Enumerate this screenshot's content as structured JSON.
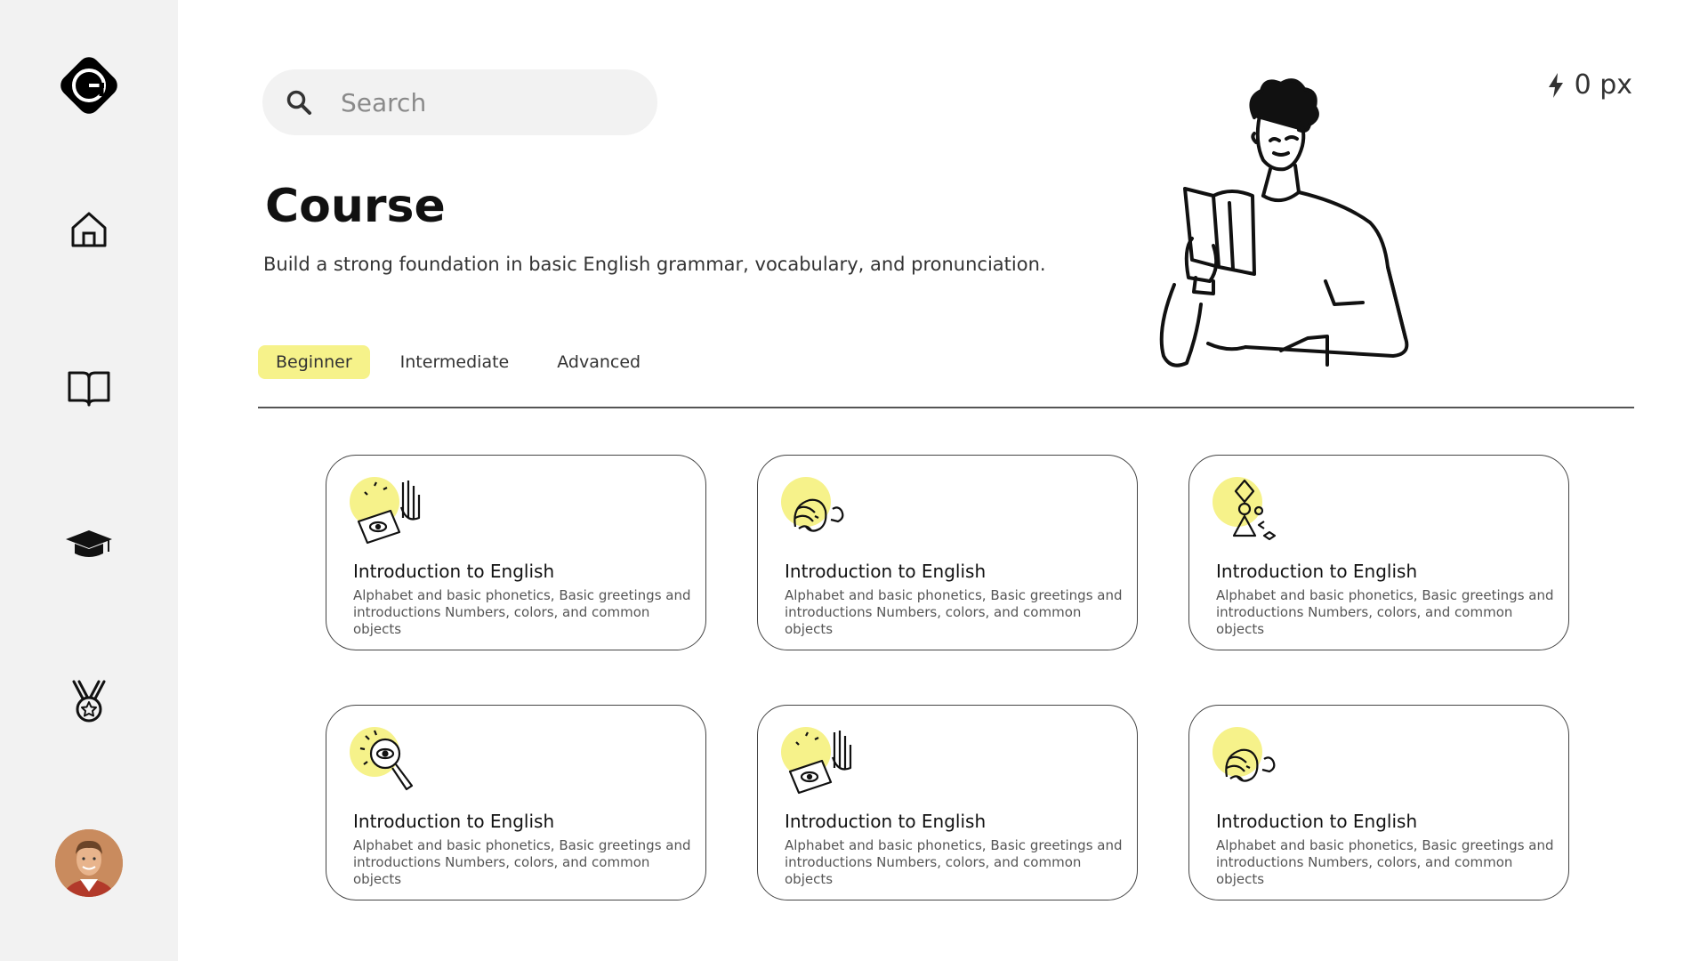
{
  "search": {
    "placeholder": "Search"
  },
  "points": {
    "value": "0 px"
  },
  "page": {
    "title": "Course",
    "subtitle": "Build a strong foundation in basic English grammar, vocabulary, and pronunciation."
  },
  "tabs": [
    {
      "label": "Beginner",
      "active": true
    },
    {
      "label": "Intermediate",
      "active": false
    },
    {
      "label": "Advanced",
      "active": false
    }
  ],
  "cards": [
    {
      "icon": "laptop-eye-icon",
      "title": "Introduction to English",
      "description": "Alphabet and basic phonetics, Basic greetings and introductions Numbers, colors, and common objects"
    },
    {
      "icon": "speaking-head-icon",
      "title": "Introduction to English",
      "description": "Alphabet and basic phonetics, Basic greetings and introductions Numbers, colors, and common objects"
    },
    {
      "icon": "shapes-figure-icon",
      "title": "Introduction to English",
      "description": "Alphabet and basic phonetics, Basic greetings and introductions Numbers, colors, and common objects"
    },
    {
      "icon": "magnifier-eye-icon",
      "title": "Introduction to English",
      "description": "Alphabet and basic phonetics, Basic greetings and introductions Numbers, colors, and common objects"
    },
    {
      "icon": "laptop-eye-icon",
      "title": "Introduction to English",
      "description": "Alphabet and basic phonetics, Basic greetings and introductions Numbers, colors, and common objects"
    },
    {
      "icon": "speaking-head-icon",
      "title": "Introduction to English",
      "description": "Alphabet and basic phonetics, Basic greetings and introductions Numbers, colors, and common objects"
    }
  ],
  "colors": {
    "accent": "#f6f28a",
    "sidebar": "#f2f2f2",
    "border": "#444444"
  },
  "sidebar": {
    "items": [
      {
        "icon": "logo-icon"
      },
      {
        "icon": "home-icon"
      },
      {
        "icon": "book-icon"
      },
      {
        "icon": "graduation-cap-icon"
      },
      {
        "icon": "medal-icon"
      },
      {
        "icon": "avatar"
      }
    ]
  }
}
